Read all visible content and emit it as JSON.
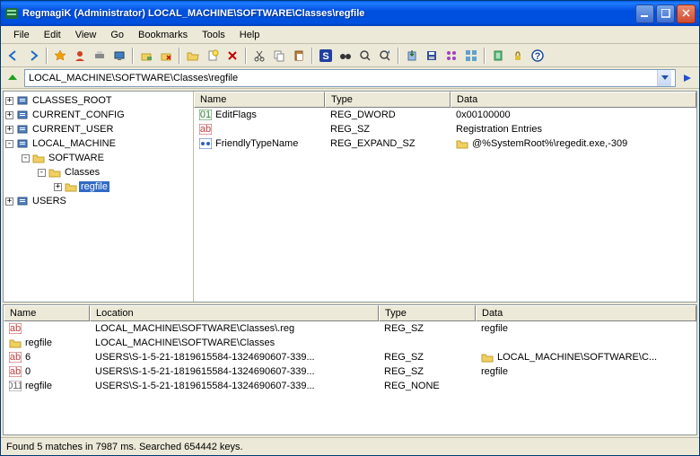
{
  "title": "RegmagiK (Administrator) LOCAL_MACHINE\\SOFTWARE\\Classes\\regfile",
  "menu": [
    "File",
    "Edit",
    "View",
    "Go",
    "Bookmarks",
    "Tools",
    "Help"
  ],
  "address": "LOCAL_MACHINE\\SOFTWARE\\Classes\\regfile",
  "tree": {
    "roots": [
      {
        "label": "CLASSES_ROOT",
        "depth": 0,
        "exp": "+"
      },
      {
        "label": "CURRENT_CONFIG",
        "depth": 0,
        "exp": "+"
      },
      {
        "label": "CURRENT_USER",
        "depth": 0,
        "exp": "+"
      },
      {
        "label": "LOCAL_MACHINE",
        "depth": 0,
        "exp": "-"
      },
      {
        "label": "SOFTWARE",
        "depth": 1,
        "exp": "-"
      },
      {
        "label": "Classes",
        "depth": 2,
        "exp": "-"
      },
      {
        "label": "regfile",
        "depth": 3,
        "exp": "+",
        "sel": true
      },
      {
        "label": "USERS",
        "depth": 0,
        "exp": "+"
      }
    ]
  },
  "list_cols": {
    "name": "Name",
    "type": "Type",
    "data": "Data"
  },
  "list_rows": [
    {
      "icon": "bin",
      "name": "EditFlags",
      "type": "REG_DWORD",
      "data": "0x00100000",
      "dicon": ""
    },
    {
      "icon": "str",
      "name": "",
      "type": "REG_SZ",
      "data": "Registration Entries",
      "dicon": ""
    },
    {
      "icon": "fstr",
      "name": "FriendlyTypeName",
      "type": "REG_EXPAND_SZ",
      "data": "@%SystemRoot%\\regedit.exe,-309",
      "dicon": "fold"
    }
  ],
  "bot_cols": {
    "name": "Name",
    "location": "Location",
    "type": "Type",
    "data": "Data"
  },
  "bot_rows": [
    {
      "icon": "str",
      "name": "",
      "location": "LOCAL_MACHINE\\SOFTWARE\\Classes\\.reg",
      "type": "REG_SZ",
      "data": "regfile",
      "dicon": ""
    },
    {
      "icon": "fold",
      "name": "regfile",
      "location": "LOCAL_MACHINE\\SOFTWARE\\Classes",
      "type": "",
      "data": "",
      "dicon": ""
    },
    {
      "icon": "str",
      "name": "6",
      "location": "USERS\\S-1-5-21-1819615584-1324690607-339...",
      "type": "REG_SZ",
      "data": "LOCAL_MACHINE\\SOFTWARE\\C...",
      "dicon": "fold"
    },
    {
      "icon": "str",
      "name": "0",
      "location": "USERS\\S-1-5-21-1819615584-1324690607-339...",
      "type": "REG_SZ",
      "data": "regfile",
      "dicon": ""
    },
    {
      "icon": "bin2",
      "name": "regfile",
      "location": "USERS\\S-1-5-21-1819615584-1324690607-339...",
      "type": "REG_NONE",
      "data": "",
      "dicon": ""
    }
  ],
  "status": "Found 5 matches in 7987 ms. Searched 654442 keys.",
  "colwidths": {
    "top_name": 146,
    "top_type": 140,
    "top_data": 260,
    "bot_name": 96,
    "bot_loc": 322,
    "bot_type": 108,
    "bot_data": 230
  }
}
